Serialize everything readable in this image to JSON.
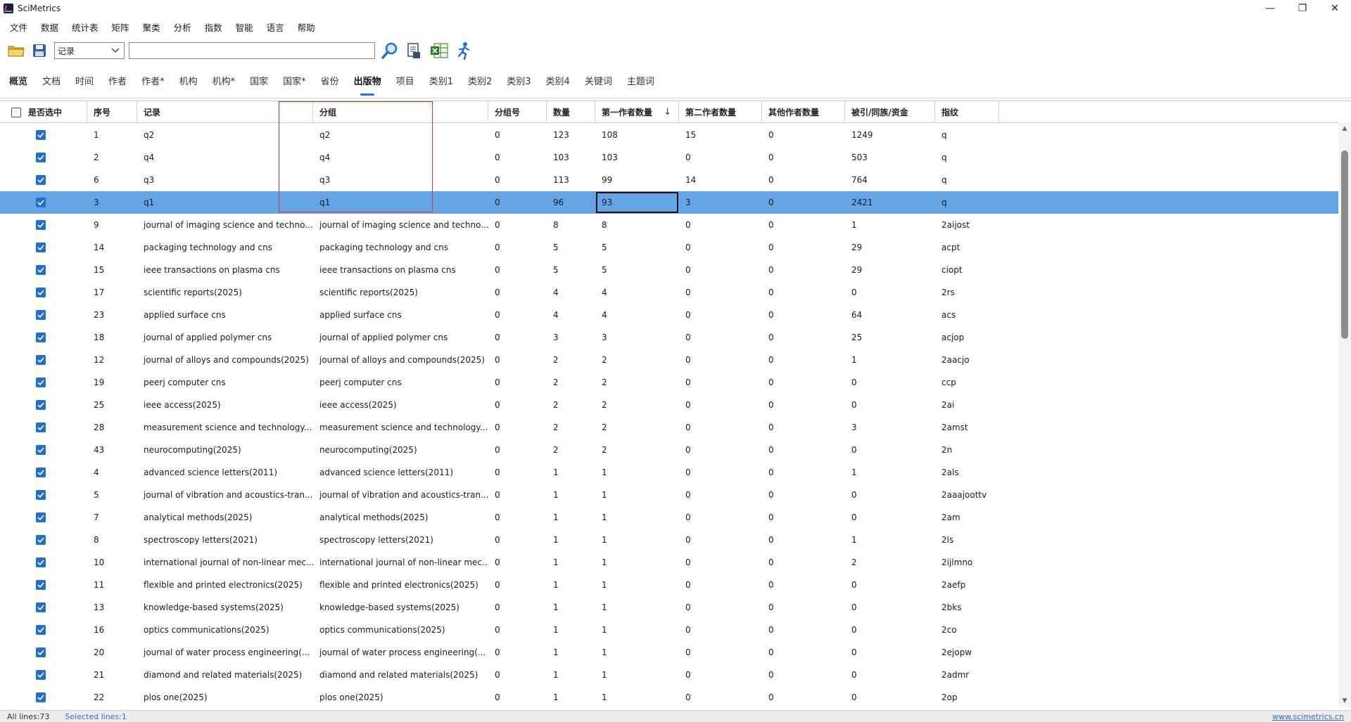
{
  "window": {
    "title": "SciMetrics",
    "minimize": "—",
    "restore": "❐",
    "close": "✕"
  },
  "menu": [
    "文件",
    "数据",
    "统计表",
    "矩阵",
    "聚类",
    "分析",
    "指数",
    "智能",
    "语言",
    "帮助"
  ],
  "toolbar": {
    "field_select_value": "记录",
    "search_value": ""
  },
  "tabs": [
    "概览",
    "文档",
    "时间",
    "作者",
    "作者*",
    "机构",
    "机构*",
    "国家",
    "国家*",
    "省份",
    "出版物",
    "项目",
    "类别1",
    "类别2",
    "类别3",
    "类别4",
    "关键词",
    "主题词"
  ],
  "active_tab": "出版物",
  "grid": {
    "columns": [
      "是否选中",
      "序号",
      "记录",
      "分组",
      "分组号",
      "数量",
      "第一作者数量",
      "第二作者数量",
      "其他作者数量",
      "被引/同族/资金",
      "指纹"
    ],
    "sort_column": "第一作者数量",
    "sort_direction": "descending",
    "selected_row_index": 3,
    "rows": [
      {
        "checked": true,
        "seq": "1",
        "record": "q2",
        "group": "q2",
        "group_no": "0",
        "count": "123",
        "first": "108",
        "second": "15",
        "other": "0",
        "cited": "1249",
        "fp": "q"
      },
      {
        "checked": true,
        "seq": "2",
        "record": "q4",
        "group": "q4",
        "group_no": "0",
        "count": "103",
        "first": "103",
        "second": "0",
        "other": "0",
        "cited": "503",
        "fp": "q"
      },
      {
        "checked": true,
        "seq": "6",
        "record": "q3",
        "group": "q3",
        "group_no": "0",
        "count": "113",
        "first": "99",
        "second": "14",
        "other": "0",
        "cited": "764",
        "fp": "q"
      },
      {
        "checked": true,
        "seq": "3",
        "record": "q1",
        "group": "q1",
        "group_no": "0",
        "count": "96",
        "first": "93",
        "second": "3",
        "other": "0",
        "cited": "2421",
        "fp": "q"
      },
      {
        "checked": true,
        "seq": "9",
        "record": "journal of imaging science and techno...",
        "group": "journal of imaging science and techno...",
        "group_no": "0",
        "count": "8",
        "first": "8",
        "second": "0",
        "other": "0",
        "cited": "1",
        "fp": "2aijost"
      },
      {
        "checked": true,
        "seq": "14",
        "record": "packaging technology and cns",
        "group": "packaging technology and cns",
        "group_no": "0",
        "count": "5",
        "first": "5",
        "second": "0",
        "other": "0",
        "cited": "29",
        "fp": "acpt"
      },
      {
        "checked": true,
        "seq": "15",
        "record": "ieee transactions on plasma cns",
        "group": "ieee transactions on plasma cns",
        "group_no": "0",
        "count": "5",
        "first": "5",
        "second": "0",
        "other": "0",
        "cited": "29",
        "fp": "ciopt"
      },
      {
        "checked": true,
        "seq": "17",
        "record": "scientific reports(2025)",
        "group": "scientific reports(2025)",
        "group_no": "0",
        "count": "4",
        "first": "4",
        "second": "0",
        "other": "0",
        "cited": "0",
        "fp": "2rs"
      },
      {
        "checked": true,
        "seq": "23",
        "record": "applied surface cns",
        "group": "applied surface cns",
        "group_no": "0",
        "count": "4",
        "first": "4",
        "second": "0",
        "other": "0",
        "cited": "64",
        "fp": "acs"
      },
      {
        "checked": true,
        "seq": "18",
        "record": "journal of applied polymer cns",
        "group": "journal of applied polymer cns",
        "group_no": "0",
        "count": "3",
        "first": "3",
        "second": "0",
        "other": "0",
        "cited": "25",
        "fp": "acjop"
      },
      {
        "checked": true,
        "seq": "12",
        "record": "journal of alloys and compounds(2025)",
        "group": "journal of alloys and compounds(2025)",
        "group_no": "0",
        "count": "2",
        "first": "2",
        "second": "0",
        "other": "0",
        "cited": "1",
        "fp": "2aacjo"
      },
      {
        "checked": true,
        "seq": "19",
        "record": "peerj computer cns",
        "group": "peerj computer cns",
        "group_no": "0",
        "count": "2",
        "first": "2",
        "second": "0",
        "other": "0",
        "cited": "0",
        "fp": "ccp"
      },
      {
        "checked": true,
        "seq": "25",
        "record": "ieee access(2025)",
        "group": "ieee access(2025)",
        "group_no": "0",
        "count": "2",
        "first": "2",
        "second": "0",
        "other": "0",
        "cited": "0",
        "fp": "2ai"
      },
      {
        "checked": true,
        "seq": "28",
        "record": "measurement science and technology...",
        "group": "measurement science and technology...",
        "group_no": "0",
        "count": "2",
        "first": "2",
        "second": "0",
        "other": "0",
        "cited": "3",
        "fp": "2amst"
      },
      {
        "checked": true,
        "seq": "43",
        "record": "neurocomputing(2025)",
        "group": "neurocomputing(2025)",
        "group_no": "0",
        "count": "2",
        "first": "2",
        "second": "0",
        "other": "0",
        "cited": "0",
        "fp": "2n"
      },
      {
        "checked": true,
        "seq": "4",
        "record": "advanced science letters(2011)",
        "group": "advanced science letters(2011)",
        "group_no": "0",
        "count": "1",
        "first": "1",
        "second": "0",
        "other": "0",
        "cited": "1",
        "fp": "2als"
      },
      {
        "checked": true,
        "seq": "5",
        "record": "journal of vibration and acoustics-tran...",
        "group": "journal of vibration and acoustics-tran...",
        "group_no": "0",
        "count": "1",
        "first": "1",
        "second": "0",
        "other": "0",
        "cited": "0",
        "fp": "2aaajoottv"
      },
      {
        "checked": true,
        "seq": "7",
        "record": "analytical methods(2025)",
        "group": "analytical methods(2025)",
        "group_no": "0",
        "count": "1",
        "first": "1",
        "second": "0",
        "other": "0",
        "cited": "0",
        "fp": "2am"
      },
      {
        "checked": true,
        "seq": "8",
        "record": "spectroscopy letters(2021)",
        "group": "spectroscopy letters(2021)",
        "group_no": "0",
        "count": "1",
        "first": "1",
        "second": "0",
        "other": "0",
        "cited": "1",
        "fp": "2ls"
      },
      {
        "checked": true,
        "seq": "10",
        "record": "international journal of non-linear mec...",
        "group": "international journal of non-linear mec...",
        "group_no": "0",
        "count": "1",
        "first": "1",
        "second": "0",
        "other": "0",
        "cited": "2",
        "fp": "2ijlmno"
      },
      {
        "checked": true,
        "seq": "11",
        "record": "flexible and printed electronics(2025)",
        "group": "flexible and printed electronics(2025)",
        "group_no": "0",
        "count": "1",
        "first": "1",
        "second": "0",
        "other": "0",
        "cited": "0",
        "fp": "2aefp"
      },
      {
        "checked": true,
        "seq": "13",
        "record": "knowledge-based systems(2025)",
        "group": "knowledge-based systems(2025)",
        "group_no": "0",
        "count": "1",
        "first": "1",
        "second": "0",
        "other": "0",
        "cited": "0",
        "fp": "2bks"
      },
      {
        "checked": true,
        "seq": "16",
        "record": "optics communications(2025)",
        "group": "optics communications(2025)",
        "group_no": "0",
        "count": "1",
        "first": "1",
        "second": "0",
        "other": "0",
        "cited": "0",
        "fp": "2co"
      },
      {
        "checked": true,
        "seq": "20",
        "record": "journal of water process engineering(...",
        "group": "journal of water process engineering(...",
        "group_no": "0",
        "count": "1",
        "first": "1",
        "second": "0",
        "other": "0",
        "cited": "0",
        "fp": "2ejopw"
      },
      {
        "checked": true,
        "seq": "21",
        "record": "diamond and related materials(2025)",
        "group": "diamond and related materials(2025)",
        "group_no": "0",
        "count": "1",
        "first": "1",
        "second": "0",
        "other": "0",
        "cited": "0",
        "fp": "2admr"
      },
      {
        "checked": true,
        "seq": "22",
        "record": "plos one(2025)",
        "group": "plos one(2025)",
        "group_no": "0",
        "count": "1",
        "first": "1",
        "second": "0",
        "other": "0",
        "cited": "0",
        "fp": "2op"
      }
    ]
  },
  "status": {
    "all_lines": "All lines:73",
    "selected_lines": "Selected lines:1",
    "website": "www.scimetrics.cn"
  },
  "colors": {
    "selected_row": "#64a5e5",
    "checkbox": "#1f6fd0",
    "highlight_box": "#d93030",
    "tab_underline": "#2a6fdb"
  }
}
